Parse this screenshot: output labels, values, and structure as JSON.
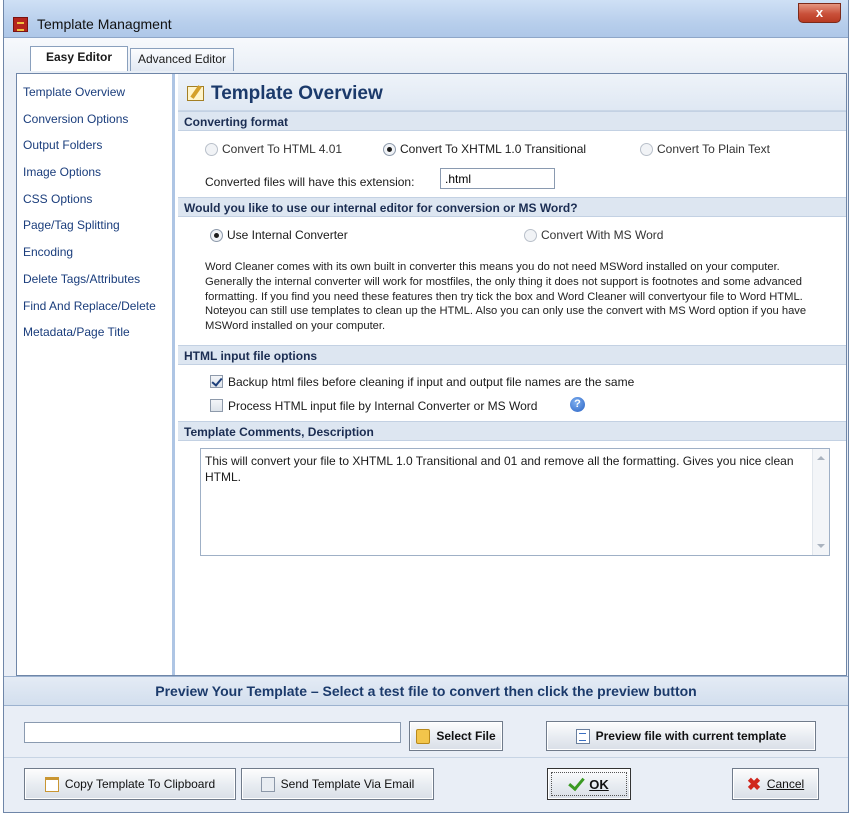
{
  "window": {
    "title": "Template Managment",
    "close_label": "x"
  },
  "tabs": [
    {
      "label": "Easy Editor",
      "active": true
    },
    {
      "label": "Advanced Editor",
      "active": false
    }
  ],
  "sidebar": {
    "items": [
      {
        "label": "Template Overview"
      },
      {
        "label": "Conversion Options"
      },
      {
        "label": "Output Folders"
      },
      {
        "label": "Image Options"
      },
      {
        "label": "CSS Options"
      },
      {
        "label": "Page/Tag Splitting"
      },
      {
        "label": "Encoding"
      },
      {
        "label": "Delete Tags/Attributes"
      },
      {
        "label": "Find And Replace/Delete"
      },
      {
        "label": "Metadata/Page Title"
      }
    ]
  },
  "main": {
    "title": "Template Overview",
    "converting_format": {
      "heading": "Converting format",
      "options": [
        {
          "label": "Convert To HTML 4.01",
          "selected": false,
          "enabled": false
        },
        {
          "label": "Convert To XHTML 1.0 Transitional",
          "selected": true,
          "enabled": true
        },
        {
          "label": "Convert To Plain Text",
          "selected": false,
          "enabled": false
        }
      ],
      "extension_label": "Converted files will have this extension:",
      "extension_value": ".html"
    },
    "editor": {
      "heading": "Would you like to use our internal editor for conversion or MS Word?",
      "options": [
        {
          "label": "Use Internal Converter",
          "selected": true,
          "enabled": true
        },
        {
          "label": "Convert With MS Word",
          "selected": false,
          "enabled": false
        }
      ],
      "description": "Word Cleaner comes with its own built in converter this means you do not need MSWord installed on your computer. Generally the internal converter will work for mostfiles, the only thing it does not support is footnotes and some advanced formatting. If you find you need these features then try tick the box and Word Cleaner will convertyour file to Word HTML. Noteyou can still use templates to clean up the HTML. Also you can only use the convert with MS Word option if you have MSWord installed on your computer."
    },
    "html_input": {
      "heading": "HTML input file options",
      "checkboxes": [
        {
          "label": "Backup html files before cleaning if input and output file names are the same",
          "checked": true
        },
        {
          "label": "Process HTML input file by Internal Converter or MS Word",
          "checked": false
        }
      ],
      "help_icon": "question-icon"
    },
    "comments": {
      "heading": "Template Comments, Description",
      "text": "This will convert your file to XHTML 1.0 Transitional and 01 and remove all the formatting. Gives you nice clean HTML."
    }
  },
  "preview": {
    "banner": "Preview Your Template – Select a test file to convert then click the preview button",
    "file_value": "",
    "select_label": "Select File",
    "preview_label": "Preview file with current template"
  },
  "footer": {
    "copy_label": "Copy Template To Clipboard",
    "email_label": "Send Template Via Email",
    "ok_label": "OK",
    "cancel_label": "Cancel"
  },
  "colors": {
    "accent": "#1b3a6b",
    "section_bg": "#dde6f1",
    "titlebar": "#b8cfec"
  }
}
